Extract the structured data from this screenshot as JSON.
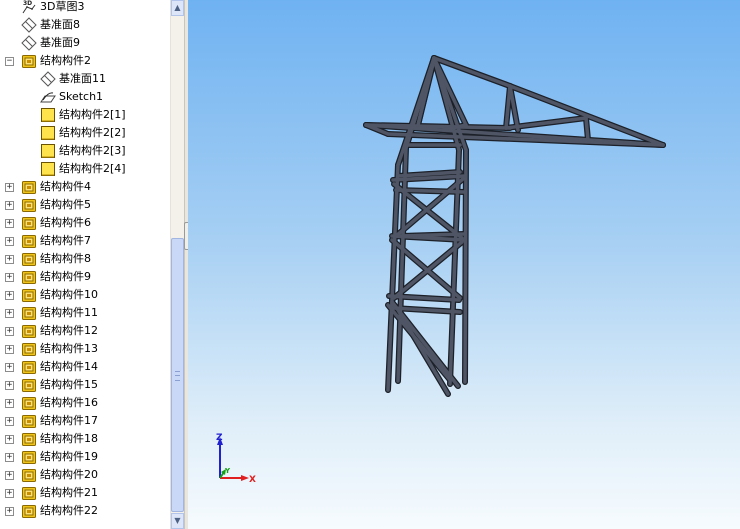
{
  "feature_tree": {
    "items": [
      {
        "label": "3D草图3",
        "icon": "3d-sketch-icon",
        "level": 1,
        "expander": ""
      },
      {
        "label": "基准面8",
        "icon": "plane-icon",
        "level": 1,
        "expander": ""
      },
      {
        "label": "基准面9",
        "icon": "plane-icon",
        "level": 1,
        "expander": ""
      },
      {
        "label": "结构构件2",
        "icon": "structure-member-folder-icon",
        "level": 1,
        "expander": "−"
      },
      {
        "label": "基准面11",
        "icon": "plane-icon",
        "level": 2,
        "expander": ""
      },
      {
        "label": "Sketch1",
        "icon": "sketch-icon",
        "level": 2,
        "expander": ""
      },
      {
        "label": "结构构件2[1]",
        "icon": "structure-member-body-icon",
        "level": 2,
        "expander": ""
      },
      {
        "label": "结构构件2[2]",
        "icon": "structure-member-body-icon",
        "level": 2,
        "expander": ""
      },
      {
        "label": "结构构件2[3]",
        "icon": "structure-member-body-icon",
        "level": 2,
        "expander": ""
      },
      {
        "label": "结构构件2[4]",
        "icon": "structure-member-body-icon",
        "level": 2,
        "expander": ""
      },
      {
        "label": "结构构件4",
        "icon": "structure-member-folder-icon",
        "level": 1,
        "expander": "+"
      },
      {
        "label": "结构构件5",
        "icon": "structure-member-folder-icon",
        "level": 1,
        "expander": "+"
      },
      {
        "label": "结构构件6",
        "icon": "structure-member-folder-icon",
        "level": 1,
        "expander": "+"
      },
      {
        "label": "结构构件7",
        "icon": "structure-member-folder-icon",
        "level": 1,
        "expander": "+"
      },
      {
        "label": "结构构件8",
        "icon": "structure-member-folder-icon",
        "level": 1,
        "expander": "+"
      },
      {
        "label": "结构构件9",
        "icon": "structure-member-folder-icon",
        "level": 1,
        "expander": "+"
      },
      {
        "label": "结构构件10",
        "icon": "structure-member-folder-icon",
        "level": 1,
        "expander": "+"
      },
      {
        "label": "结构构件11",
        "icon": "structure-member-folder-icon",
        "level": 1,
        "expander": "+"
      },
      {
        "label": "结构构件12",
        "icon": "structure-member-folder-icon",
        "level": 1,
        "expander": "+"
      },
      {
        "label": "结构构件13",
        "icon": "structure-member-folder-icon",
        "level": 1,
        "expander": "+"
      },
      {
        "label": "结构构件14",
        "icon": "structure-member-folder-icon",
        "level": 1,
        "expander": "+"
      },
      {
        "label": "结构构件15",
        "icon": "structure-member-folder-icon",
        "level": 1,
        "expander": "+"
      },
      {
        "label": "结构构件16",
        "icon": "structure-member-folder-icon",
        "level": 1,
        "expander": "+"
      },
      {
        "label": "结构构件17",
        "icon": "structure-member-folder-icon",
        "level": 1,
        "expander": "+"
      },
      {
        "label": "结构构件18",
        "icon": "structure-member-folder-icon",
        "level": 1,
        "expander": "+"
      },
      {
        "label": "结构构件19",
        "icon": "structure-member-folder-icon",
        "level": 1,
        "expander": "+"
      },
      {
        "label": "结构构件20",
        "icon": "structure-member-folder-icon",
        "level": 1,
        "expander": "+"
      },
      {
        "label": "结构构件21",
        "icon": "structure-member-folder-icon",
        "level": 1,
        "expander": "+"
      },
      {
        "label": "结构构件22",
        "icon": "structure-member-folder-icon",
        "level": 1,
        "expander": "+"
      }
    ]
  },
  "scrollbar": {
    "up_arrow": "▲",
    "down_arrow": "▼"
  },
  "splitter": {
    "collapse_glyph": "‹"
  },
  "triad": {
    "x_label": "X",
    "y_label": "Y",
    "z_label": "Z"
  },
  "colors": {
    "sky_top": "#6fb2f2",
    "sky_bottom": "#f6fbfe",
    "member_fill": "#4f5564",
    "member_edge": "#1c2028",
    "axis_x": "#e02020",
    "axis_y": "#14a014",
    "axis_z": "#2020d0"
  }
}
